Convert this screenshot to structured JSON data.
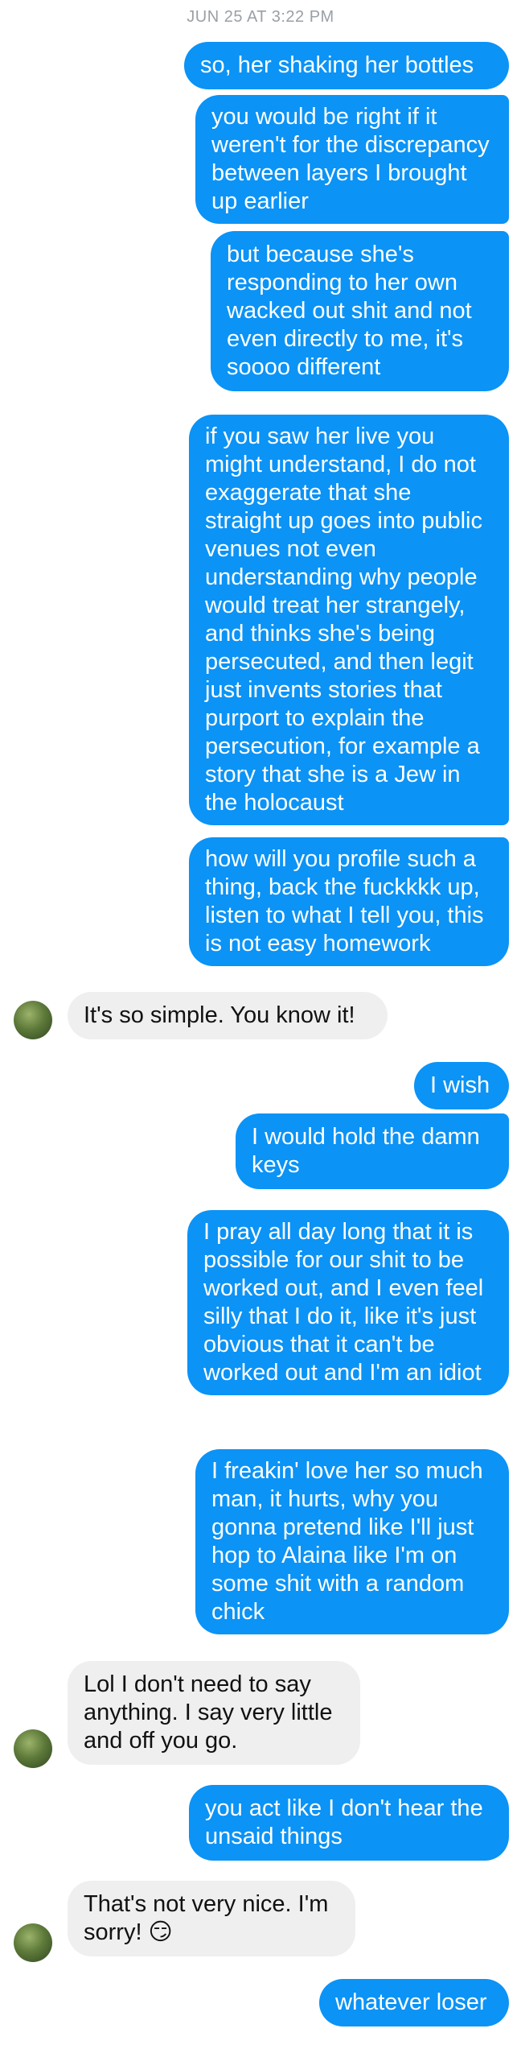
{
  "timestamp": "JUN 25 AT 3:22 PM",
  "messages": [
    {
      "from": "me",
      "text": "so, her shaking her bottles"
    },
    {
      "from": "me",
      "text": "you would be right if it weren't for the discrepancy between layers I brought up earlier"
    },
    {
      "from": "me",
      "text": "but because she's responding to her own wacked out shit and not even directly to me, it's soooo different"
    },
    {
      "from": "me",
      "text": "if you saw her live you might understand, I do not exaggerate that she straight up goes into public venues not even understanding why people would treat her strangely, and thinks she's being persecuted, and then legit just invents stories that purport to explain the persecution, for example a story that she is a Jew in the holocaust"
    },
    {
      "from": "me",
      "text": "how will you profile such a thing, back the fuckkkk up, listen to what I tell you, this is not easy homework"
    },
    {
      "from": "them",
      "text": "It's so simple. You know it!"
    },
    {
      "from": "me",
      "text": "I wish"
    },
    {
      "from": "me",
      "text": "I would hold the damn keys"
    },
    {
      "from": "me",
      "text": "I pray all day long that it is possible for our shit to be worked out, and I even feel silly that I do it, like it's just obvious that it can't be worked out and I'm an idiot"
    },
    {
      "from": "me",
      "text": "I freakin' love her so much man, it hurts, why you gonna pretend like I'll just hop to Alaina like I'm on some shit with a random chick"
    },
    {
      "from": "them",
      "text": "Lol I don't need to say anything. I say very little and off you go."
    },
    {
      "from": "me",
      "text": "you act like I don't hear the unsaid things"
    },
    {
      "from": "them",
      "text": "That's not very nice. I'm sorry! 😏"
    },
    {
      "from": "me",
      "text": "whatever loser"
    }
  ],
  "colors": {
    "outgoing_bg": "#0b93f6",
    "incoming_bg": "#efefef"
  },
  "contact_avatar_icon": "contact-avatar-photo"
}
